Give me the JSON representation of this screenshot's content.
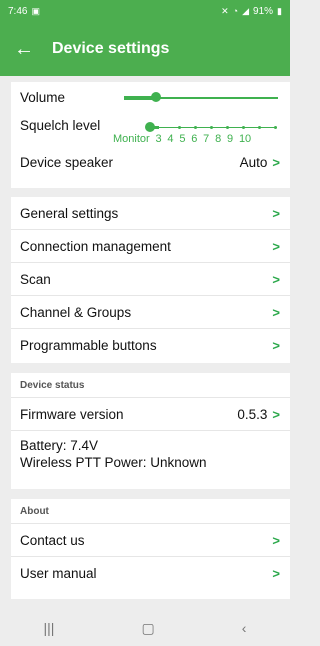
{
  "status_bar": {
    "time": "7:46",
    "battery": "91%"
  },
  "app_bar": {
    "title": "Device settings"
  },
  "audio": {
    "volume_label": "Volume",
    "volume_level": 0.2,
    "squelch_label": "Squelch level",
    "squelch_ticks": [
      "Monitor",
      "3",
      "4",
      "5",
      "6",
      "7",
      "8",
      "9",
      "10"
    ],
    "squelch_selected": "Monitor",
    "speaker_label": "Device speaker",
    "speaker_value": "Auto"
  },
  "menu": [
    {
      "label": "General settings"
    },
    {
      "label": "Connection management"
    },
    {
      "label": "Scan"
    },
    {
      "label": "Channel & Groups"
    },
    {
      "label": "Programmable buttons"
    }
  ],
  "device_status": {
    "heading": "Device status",
    "firmware_label": "Firmware version",
    "firmware_value": "0.5.3",
    "battery_line": "Battery: 7.4V",
    "ptt_line": "Wireless PTT Power: Unknown"
  },
  "about": {
    "heading": "About",
    "items": [
      {
        "label": "Contact us"
      },
      {
        "label": "User manual"
      }
    ]
  },
  "colors": {
    "accent": "#4cae4f",
    "chevron": "#2aa84a"
  },
  "icons": {
    "back": "arrow-left-icon",
    "chevron": "chevron-right-icon"
  }
}
